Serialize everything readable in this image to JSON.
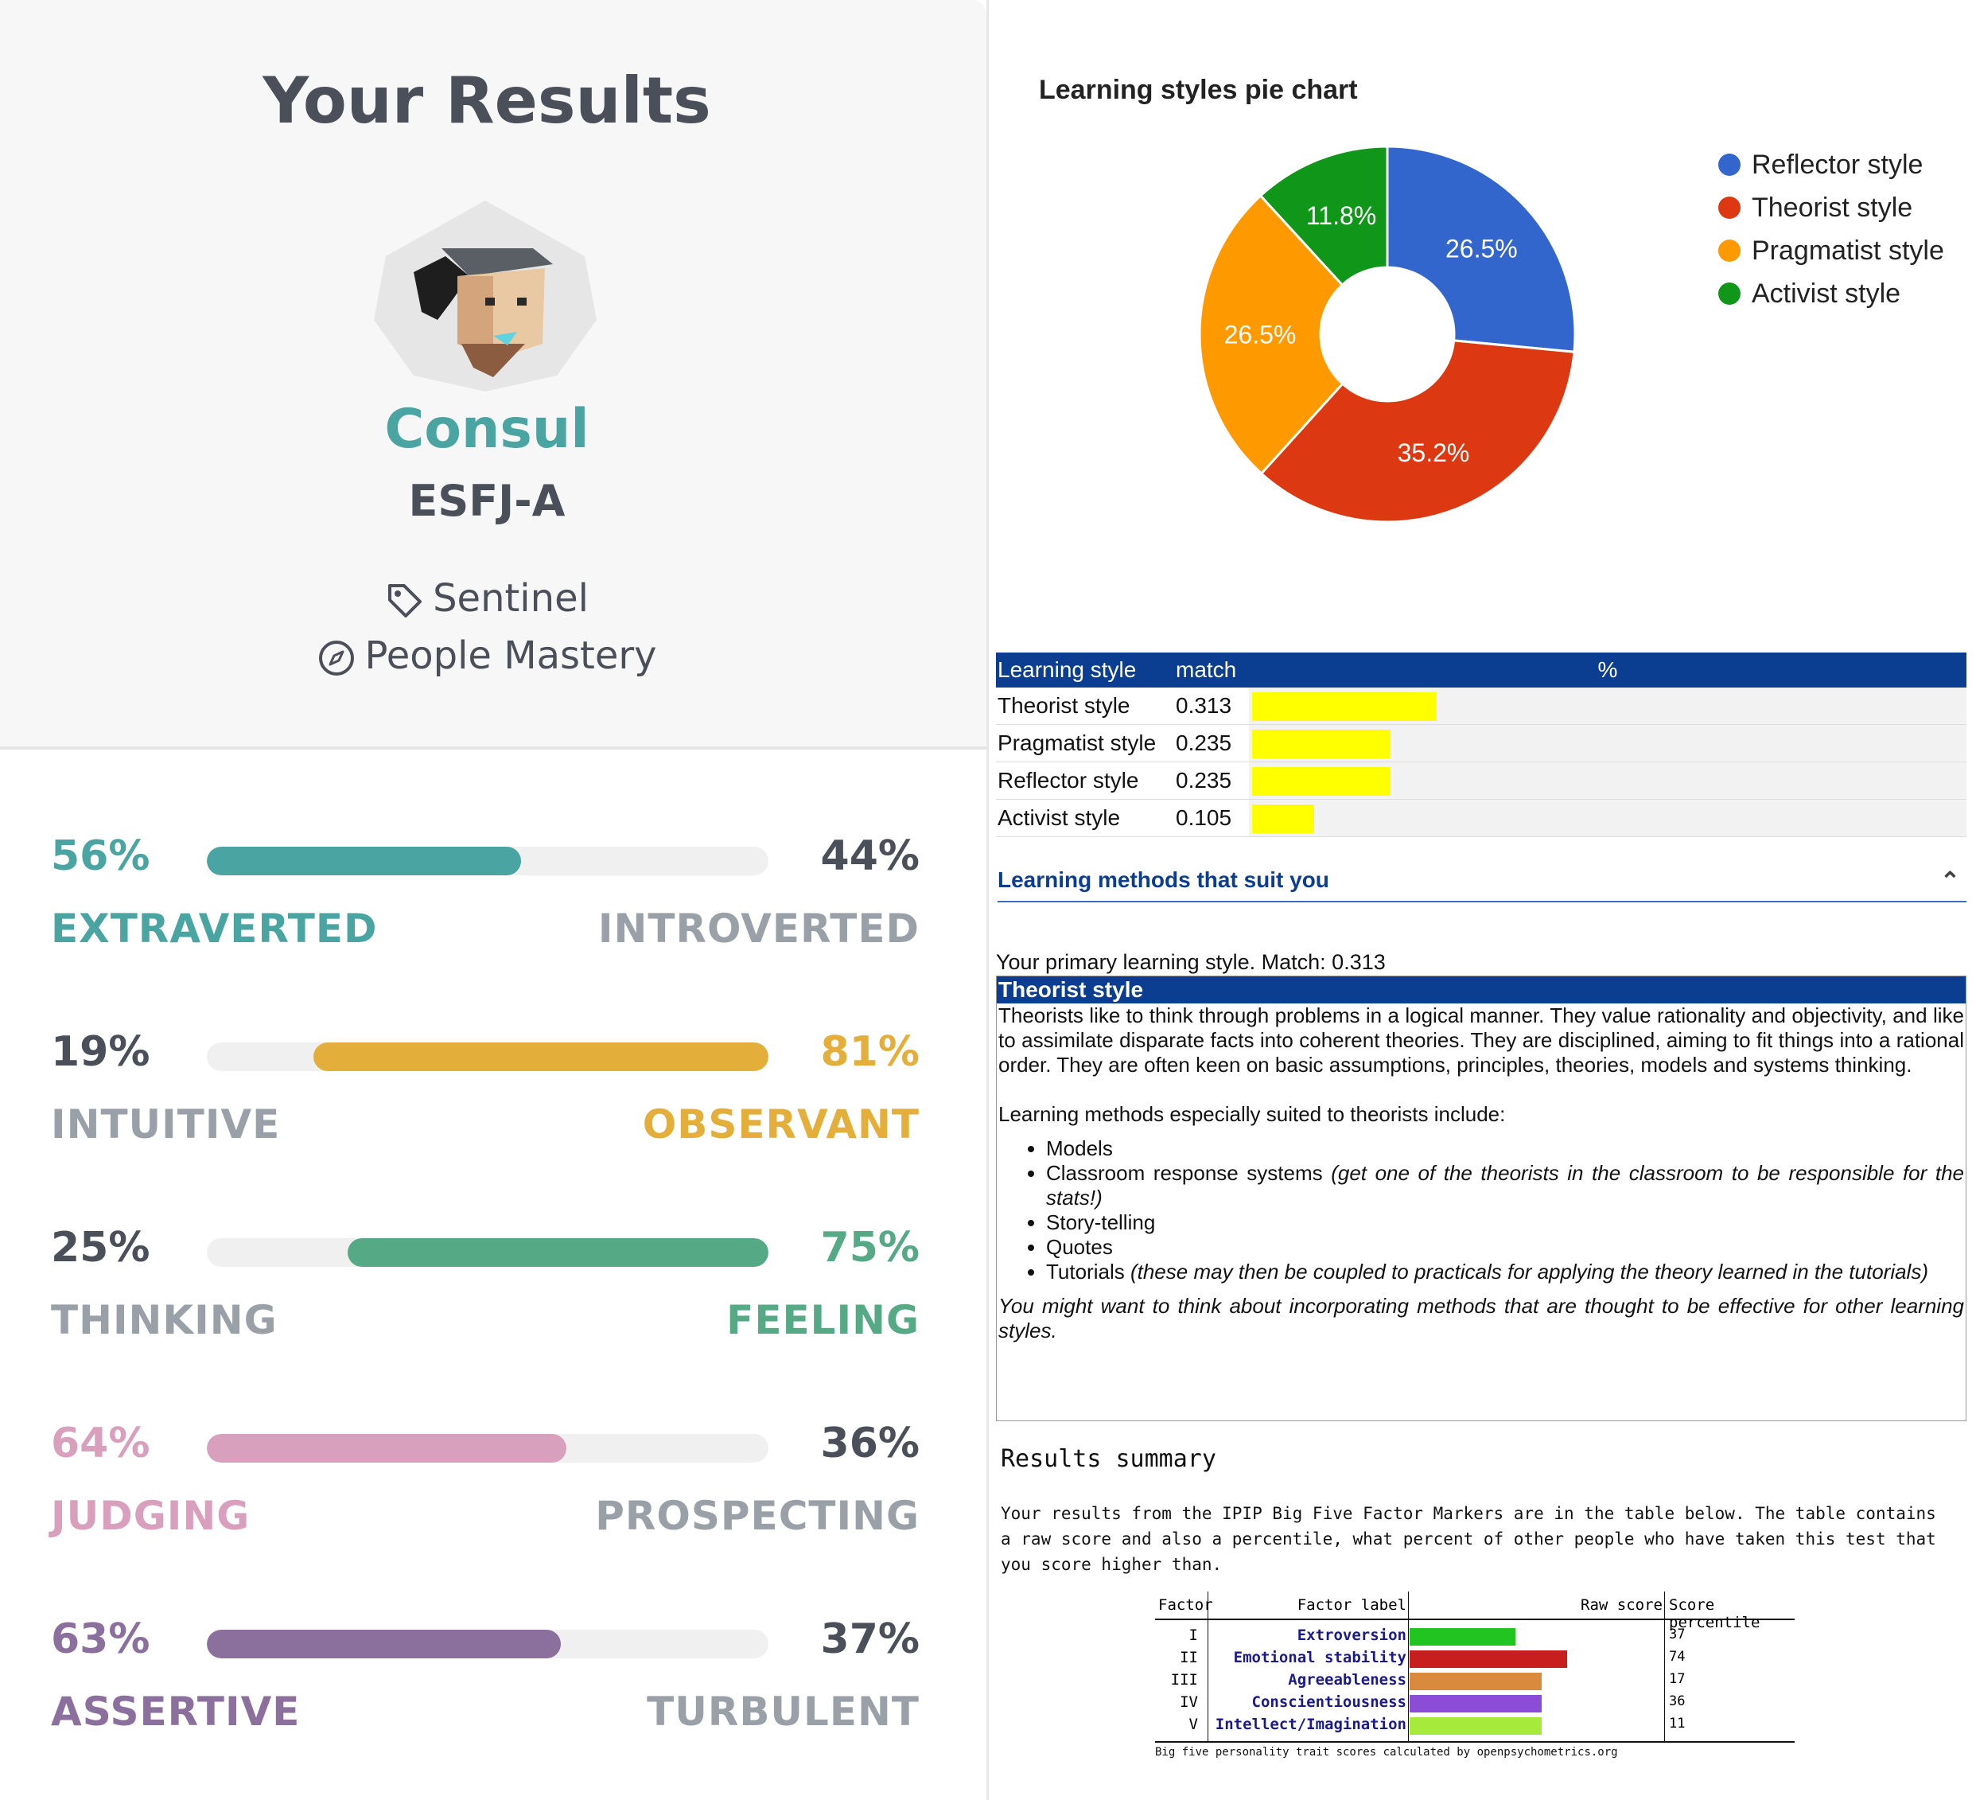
{
  "personality": {
    "title": "Your Results",
    "type_name": "Consul",
    "type_code": "ESFJ-A",
    "role": "Sentinel",
    "strategy": "People Mastery",
    "traits": [
      {
        "left_pct": "56%",
        "right_pct": "44%",
        "left_label": "EXTRAVERTED",
        "right_label": "INTROVERTED",
        "value": 0.56,
        "dominant": "left",
        "color": "#4aa4a1"
      },
      {
        "left_pct": "19%",
        "right_pct": "81%",
        "left_label": "INTUITIVE",
        "right_label": "OBSERVANT",
        "value": 0.81,
        "dominant": "right",
        "color": "#e4ae3a"
      },
      {
        "left_pct": "25%",
        "right_pct": "75%",
        "left_label": "THINKING",
        "right_label": "FEELING",
        "value": 0.75,
        "dominant": "right",
        "color": "#56a985"
      },
      {
        "left_pct": "64%",
        "right_pct": "36%",
        "left_label": "JUDGING",
        "right_label": "PROSPECTING",
        "value": 0.64,
        "dominant": "left",
        "color": "#d8a0bc"
      },
      {
        "left_pct": "63%",
        "right_pct": "37%",
        "left_label": "ASSERTIVE",
        "right_label": "TURBULENT",
        "value": 0.63,
        "dominant": "left",
        "color": "#8b6f9c"
      }
    ]
  },
  "chart_data": {
    "type": "pie",
    "title": "Learning styles pie chart",
    "donut": true,
    "categories": [
      "Reflector style",
      "Theorist style",
      "Pragmatist style",
      "Activist style"
    ],
    "values": [
      26.5,
      35.2,
      26.5,
      11.8
    ],
    "labels": [
      "26.5%",
      "35.2%",
      "26.5%",
      "11.8%"
    ],
    "colors": [
      "#3366cc",
      "#dc3912",
      "#ff9900",
      "#109618"
    ],
    "legend": "right"
  },
  "styles_table": {
    "headers": [
      "Learning style",
      "match",
      "%"
    ],
    "rows": [
      {
        "style": "Theorist style",
        "match": "0.313",
        "value": 0.313
      },
      {
        "style": "Pragmatist style",
        "match": "0.235",
        "value": 0.235
      },
      {
        "style": "Reflector style",
        "match": "0.235",
        "value": 0.235
      },
      {
        "style": "Activist style",
        "match": "0.105",
        "value": 0.105
      }
    ]
  },
  "methods": {
    "heading": "Learning methods that suit you",
    "primary": "Your primary learning style. Match: 0.313",
    "style_title": "Theorist style",
    "description": "Theorists like to think through problems in a logical manner. They value rationality and objectivity, and like to assimilate disparate facts into coherent theories. They are disciplined, aiming to fit things into a rational order. They are often keen on basic assumptions, principles, theories, models and systems thinking.",
    "list_intro": "Learning methods especially suited to theorists include:",
    "items": [
      {
        "text": "Models",
        "note": ""
      },
      {
        "text": "Classroom response systems",
        "note": "(get one of the theorists in the classroom to be responsible for the stats!)"
      },
      {
        "text": "Story-telling",
        "note": ""
      },
      {
        "text": "Quotes",
        "note": ""
      },
      {
        "text": "Tutorials",
        "note": "(these may then be coupled to practicals for applying the theory learned in the tutorials)"
      }
    ],
    "closing": "You might want to think about incorporating methods that are thought to be effective for other learning styles."
  },
  "summary": {
    "title": "Results summary",
    "text": "Your results from the IPIP Big Five Factor Markers are in the table below. The table contains a raw score and also a percentile, what percent of other people who have taken this test that you score higher than.",
    "headers": [
      "Factor",
      "Factor label",
      "Raw score",
      "Score percentile"
    ],
    "rows": [
      {
        "factor": "I",
        "label": "Extroversion",
        "raw": 0.58,
        "percentile": "37",
        "color": "#22c422"
      },
      {
        "factor": "II",
        "label": "Emotional stability",
        "raw": 0.86,
        "percentile": "74",
        "color": "#c81e1e"
      },
      {
        "factor": "III",
        "label": "Agreeableness",
        "raw": 0.72,
        "percentile": "17",
        "color": "#d98a3c"
      },
      {
        "factor": "IV",
        "label": "Conscientiousness",
        "raw": 0.72,
        "percentile": "36",
        "color": "#8c4cd6"
      },
      {
        "factor": "V",
        "label": "Intellect/Imagination",
        "raw": 0.72,
        "percentile": "11",
        "color": "#a6ea3c"
      }
    ],
    "footer": "Big five personality trait scores calculated by openpsychometrics.org"
  }
}
